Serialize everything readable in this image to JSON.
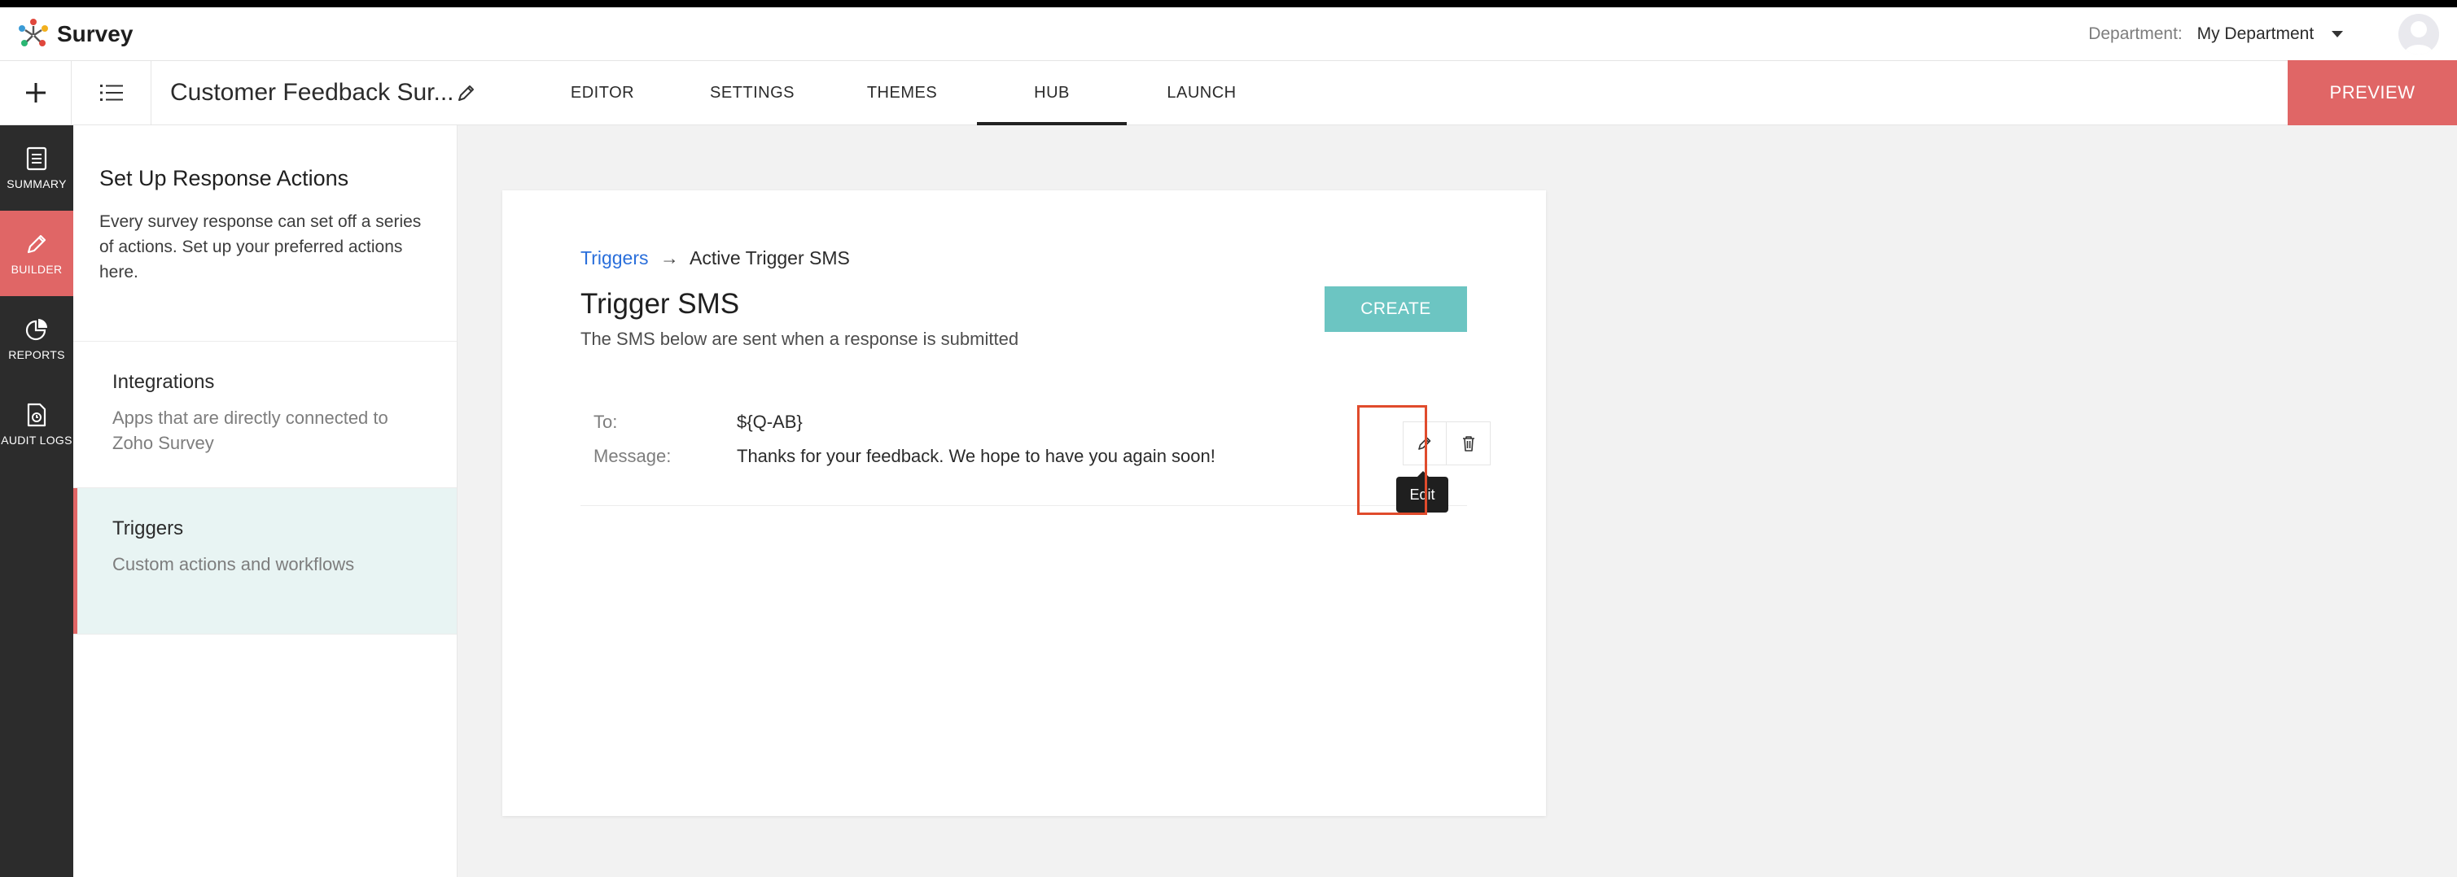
{
  "app": {
    "name": "Survey"
  },
  "header": {
    "department_label": "Department:",
    "department_value": "My Department"
  },
  "toolbar": {
    "survey_title": "Customer Feedback Sur...",
    "tabs": [
      {
        "label": "EDITOR"
      },
      {
        "label": "SETTINGS"
      },
      {
        "label": "THEMES"
      },
      {
        "label": "HUB",
        "active": true
      },
      {
        "label": "LAUNCH"
      }
    ],
    "preview_label": "PREVIEW"
  },
  "leftnav": {
    "items": [
      {
        "label": "SUMMARY",
        "icon": "document-icon"
      },
      {
        "label": "BUILDER",
        "icon": "pencil-icon",
        "active": true
      },
      {
        "label": "REPORTS",
        "icon": "pie-chart-icon"
      },
      {
        "label": "AUDIT LOGS",
        "icon": "audit-log-icon"
      }
    ]
  },
  "panel": {
    "title": "Set Up Response Actions",
    "description": "Every survey response can set off a series of actions. Set up your preferred actions here.",
    "items": [
      {
        "title": "Integrations",
        "description": "Apps that are directly connected to Zoho Survey"
      },
      {
        "title": "Triggers",
        "description": "Custom actions and workflows",
        "active": true
      }
    ]
  },
  "main": {
    "breadcrumb_link": "Triggers",
    "breadcrumb_arrow": "→",
    "breadcrumb_current": "Active Trigger SMS",
    "title": "Trigger SMS",
    "subtitle": "The SMS below are sent when a response is submitted",
    "create_label": "CREATE",
    "sms": {
      "to_label": "To:",
      "to_value": "${Q-AB}",
      "message_label": "Message:",
      "message_value": "Thanks for your feedback. We hope to have you again soon!"
    },
    "edit_tooltip": "Edit"
  },
  "colors": {
    "accent_red": "#e06666",
    "create_teal": "#6cc5c2",
    "link_blue": "#2a6fdb",
    "highlight": "#e04b2c",
    "nav_dark": "#2c2c2c"
  }
}
